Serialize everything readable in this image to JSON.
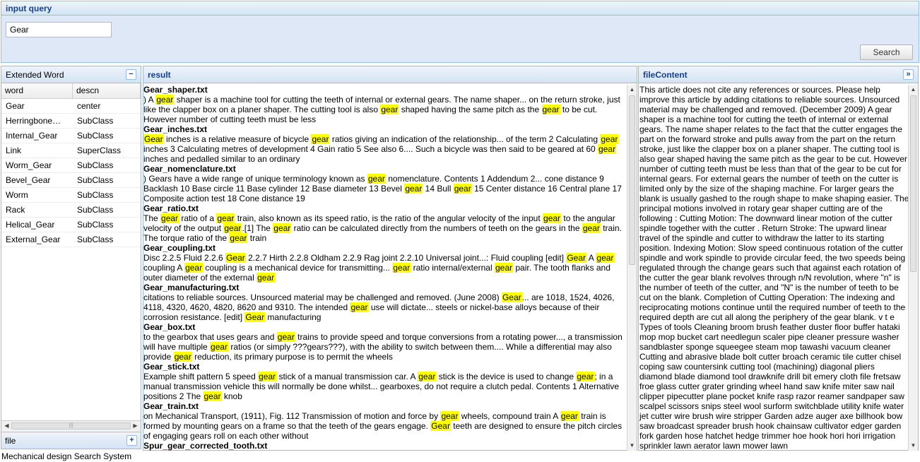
{
  "query_panel": {
    "title": "input query",
    "query_value": "Gear",
    "search_label": "Search"
  },
  "extended_word": {
    "title": "Extended Word",
    "collapse_icon": "minus-icon",
    "columns": {
      "word": "word",
      "descn": "descn"
    },
    "rows": [
      {
        "word": "Gear",
        "descn": "center"
      },
      {
        "word": "Herringbone_Gear",
        "word_display": "Herringbone…",
        "descn": "SubClass"
      },
      {
        "word": "Internal_Gear",
        "descn": "SubClass"
      },
      {
        "word": "Link",
        "descn": "SuperClass"
      },
      {
        "word": "Worm_Gear",
        "descn": "SubClass"
      },
      {
        "word": "Bevel_Gear",
        "descn": "SubClass"
      },
      {
        "word": "Worm",
        "descn": "SubClass"
      },
      {
        "word": "Rack",
        "descn": "SubClass"
      },
      {
        "word": "Helical_Gear",
        "descn": "SubClass"
      },
      {
        "word": "External_Gear",
        "descn": "SubClass"
      }
    ]
  },
  "file_panel": {
    "title": "file",
    "expand_icon": "plus-icon"
  },
  "result_panel": {
    "title": "result",
    "results": [
      {
        "file": "Gear_shaper.txt",
        "snippet": ") A [gear] shaper is a machine tool for cutting the teeth of internal or external gears. The name shaper... on the return stroke, just like the clapper box on a planer shaper. The cutting tool is also [gear] shaped having the same pitch as the [gear] to be cut. However number of cutting teeth must be less"
      },
      {
        "file": "Gear_inches.txt",
        "snippet": "[Gear] inches is a relative measure of bicycle [gear] ratios giving an indication of the relationship... of the term 2 Calculating [gear] inches 3 Calculating metres of development 4 Gain ratio 5 See also 6.... Such a bicycle was then said to be geared at 60 [gear] inches and pedalled similar to an ordinary"
      },
      {
        "file": "Gear_nomenclature.txt",
        "snippet": ") Gears have a wide range of unique terminology known as [gear] nomenclature. Contents 1 Addendum 2... cone distance 9 Backlash 10 Base circle 11 Base cylinder 12 Base diameter 13 Bevel [gear] 14 Bull [gear] 15 Center distance 16 Central plane 17 Composite action test 18 Cone distance 19"
      },
      {
        "file": "Gear_ratio.txt",
        "snippet": "The [gear] ratio of a [gear] train, also known as its speed ratio, is the ratio of the angular velocity of the input [gear] to the angular velocity of the output [gear].[1] The [gear] ratio can be calculated directly from the numbers of teeth on the gears in the [gear] train. The torque ratio of the [gear] train"
      },
      {
        "file": "Gear_coupling.txt",
        "snippet": "Disc 2.2.5 Fluid 2.2.6 [Gear] 2.2.7 Hirth 2.2.8 Oldham 2.2.9 Rag joint 2.2.10 Universal joint...: Fluid coupling [edit] [Gear] A [gear] coupling A [gear] coupling is a mechanical device for transmitting... [gear] ratio internal/external [gear] pair. The tooth flanks and outer diameter of the external [gear]"
      },
      {
        "file": "Gear_manufacturing.txt",
        "snippet": "citations to reliable sources. Unsourced material may be challenged and removed. (June 2008) [Gear]... are 1018, 1524, 4026, 4118, 4320, 4620, 4820, 8620 and 9310. The intended [gear] use will dictate... steels or nickel-base alloys because of their corrosion resistance. [edit] [Gear] manufacturing"
      },
      {
        "file": "Gear_box.txt",
        "snippet": "to the gearbox that uses gears and [gear] trains to provide speed and torque conversions from a rotating power..., a transmission will have multiple [gear] ratios (or simply ???gears???), with the ability to switch between them.... While a differential may also provide [gear] reduction, its primary purpose is to permit the wheels"
      },
      {
        "file": "Gear_stick.txt",
        "snippet": "Example shift pattern 5 speed [gear] stick of a manual transmission car. A [gear] stick is the device is used to change [gear]; in a manual transmission vehicle this will normally be done whilst... gearboxes, do not require a clutch pedal. Contents 1 Alternative positions 2 The [gear] knob"
      },
      {
        "file": "Gear_train.txt",
        "snippet": "on Mechanical Transport, (1911), Fig. 112 Transmission of motion and force by [gear] wheels, compound train A [gear] train is formed by mounting gears on a frame so that the teeth of the gears engage. [Gear] teeth are designed to ensure the pitch circles of engaging gears roll on each other without"
      },
      {
        "file": "Spur_gear_corrected_tooth.txt",
        "snippet": ""
      }
    ]
  },
  "content_panel": {
    "title": "fileContent",
    "expand_icon": "double-chevron-right-icon",
    "text": "This article does not cite any references or sources. Please help improve this article by adding citations to reliable sources. Unsourced material may be challenged and removed. (December 2009) A gear shaper is a machine tool for cutting the teeth of internal or external gears. The name shaper relates to the fact that the cutter engages the part on the forward stroke and pulls away from the part on the return stroke, just like the clapper box on a planer shaper. The cutting tool is also gear shaped having the same pitch as the gear to be cut. However number of cutting teeth must be less than that of the gear to be cut for internal gears. For external gears the number of teeth on the cutter is limited only by the size of the shaping machine. For larger gears the blank is usually gashed to the rough shape to make shaping easier. The principal motions involved in rotary gear shaper cutting are of the following : Cutting Motion: The downward linear motion of the cutter spindle together with the cutter . Return Stroke: The upward linear travel of the spindle and cutter to withdraw the latter to its starting position. Indexing Motion: Slow speed continuous rotation of the cutter spindle and work spindle to provide circular feed, the two speeds being regulated through the change gears such that against each rotation of the cutter the gear blank revolves through n/N revolution, where \"n\" is the number of teeth of the cutter, and \"N\" is the number of teeth to be cut on the blank. Completion of Cutting Operation: The indexing and reciprocating motions continue until the required number of teeth to the required depth are cut all along the periphery of the gear blank. v t e Types of tools Cleaning broom brush feather duster floor buffer hataki mop mop bucket cart needlegun scaler pipe cleaner pressure washer sandblaster sponge squeegee steam mop tawashi vacuum cleaner Cutting and abrasive blade bolt cutter broach ceramic tile cutter chisel coping saw countersink cutting tool (machining) diagonal pliers diamond blade diamond tool drawknife drill bit emery cloth file fretsaw froe glass cutter grater grinding wheel hand saw knife miter saw nail clipper pipecutter plane pocket knife rasp razor reamer sandpaper saw scalpel scissors snips steel wool surform switchblade utility knife water jet cutter wire brush wire stripper Garden adze auger axe billhook bow saw broadcast spreader brush hook chainsaw cultivator edger garden fork garden hose hatchet hedge trimmer hoe hook hori hori irrigation sprinkler lawn aerator lawn mower lawn"
  },
  "footer": {
    "text": "Mechanical design Search System"
  }
}
